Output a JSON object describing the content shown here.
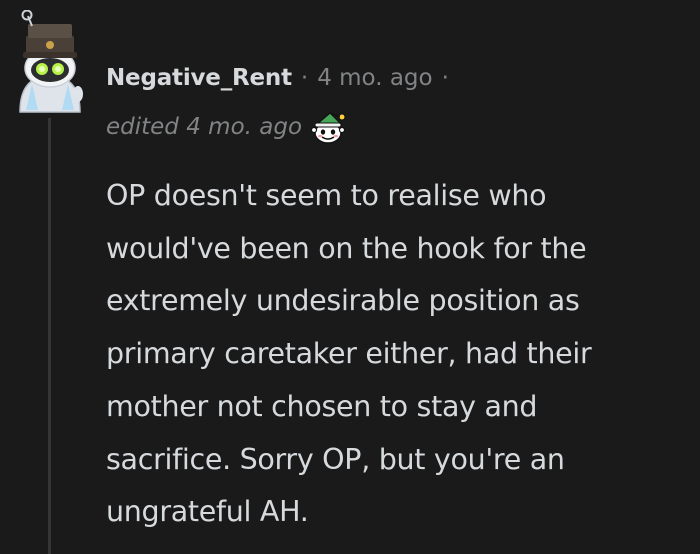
{
  "comment": {
    "author": "Negative_Rent",
    "separator": "·",
    "timestamp": "4 mo. ago",
    "trailing_separator": "·",
    "edited_label": "edited 4 mo. ago",
    "award_icon": "wholesome-snoo-elf-award-icon",
    "avatar_icon": "snoo-avatar-with-hat-and-glowing-eyes",
    "lines": [
      "OP doesn't seem to realise who",
      "would've been on the hook for the",
      "extremely undesirable position as",
      "primary caretaker either, had their",
      "mother not chosen to stay and",
      "sacrifice. Sorry OP, but you're an",
      "ungrateful AH."
    ]
  },
  "colors": {
    "background": "#1a1a1b",
    "text": "#d7dadc",
    "meta": "#818384",
    "thread_line": "#343536"
  }
}
